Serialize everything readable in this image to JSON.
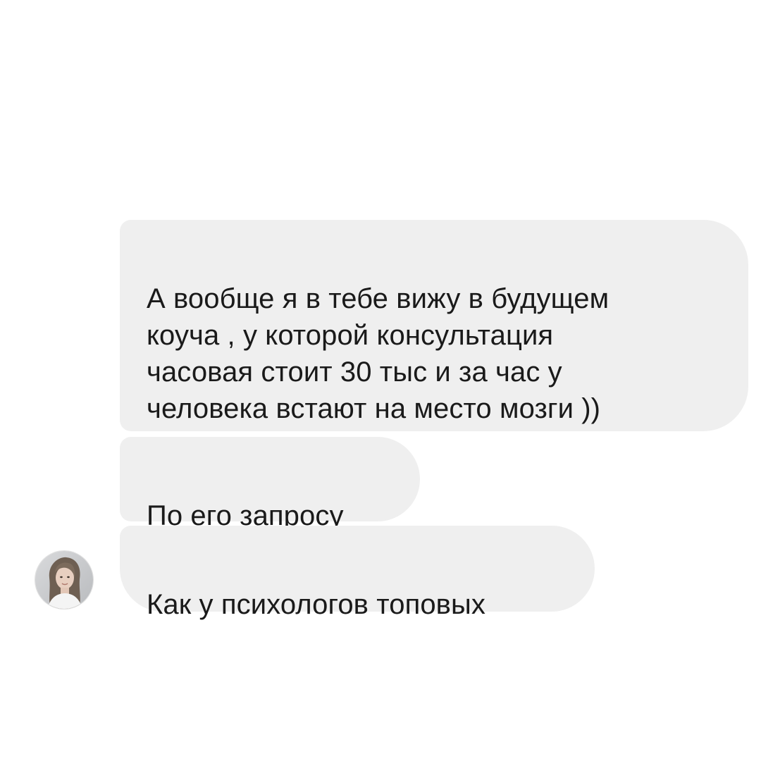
{
  "conversation": {
    "messages": [
      {
        "text": "А вообще я в тебе вижу в будущем\nкоуча , у которой консультация\nчасовая стоит 30 тыс и за час у\nчеловека встают на место мозги ))"
      },
      {
        "text": "По его запросу"
      },
      {
        "text": "Как у психологов топовых"
      }
    ],
    "bubble_color": "#efefef",
    "text_color": "#1a1a1a",
    "background_color": "#ffffff"
  },
  "sender": {
    "avatar_icon": "user-avatar-photo"
  }
}
